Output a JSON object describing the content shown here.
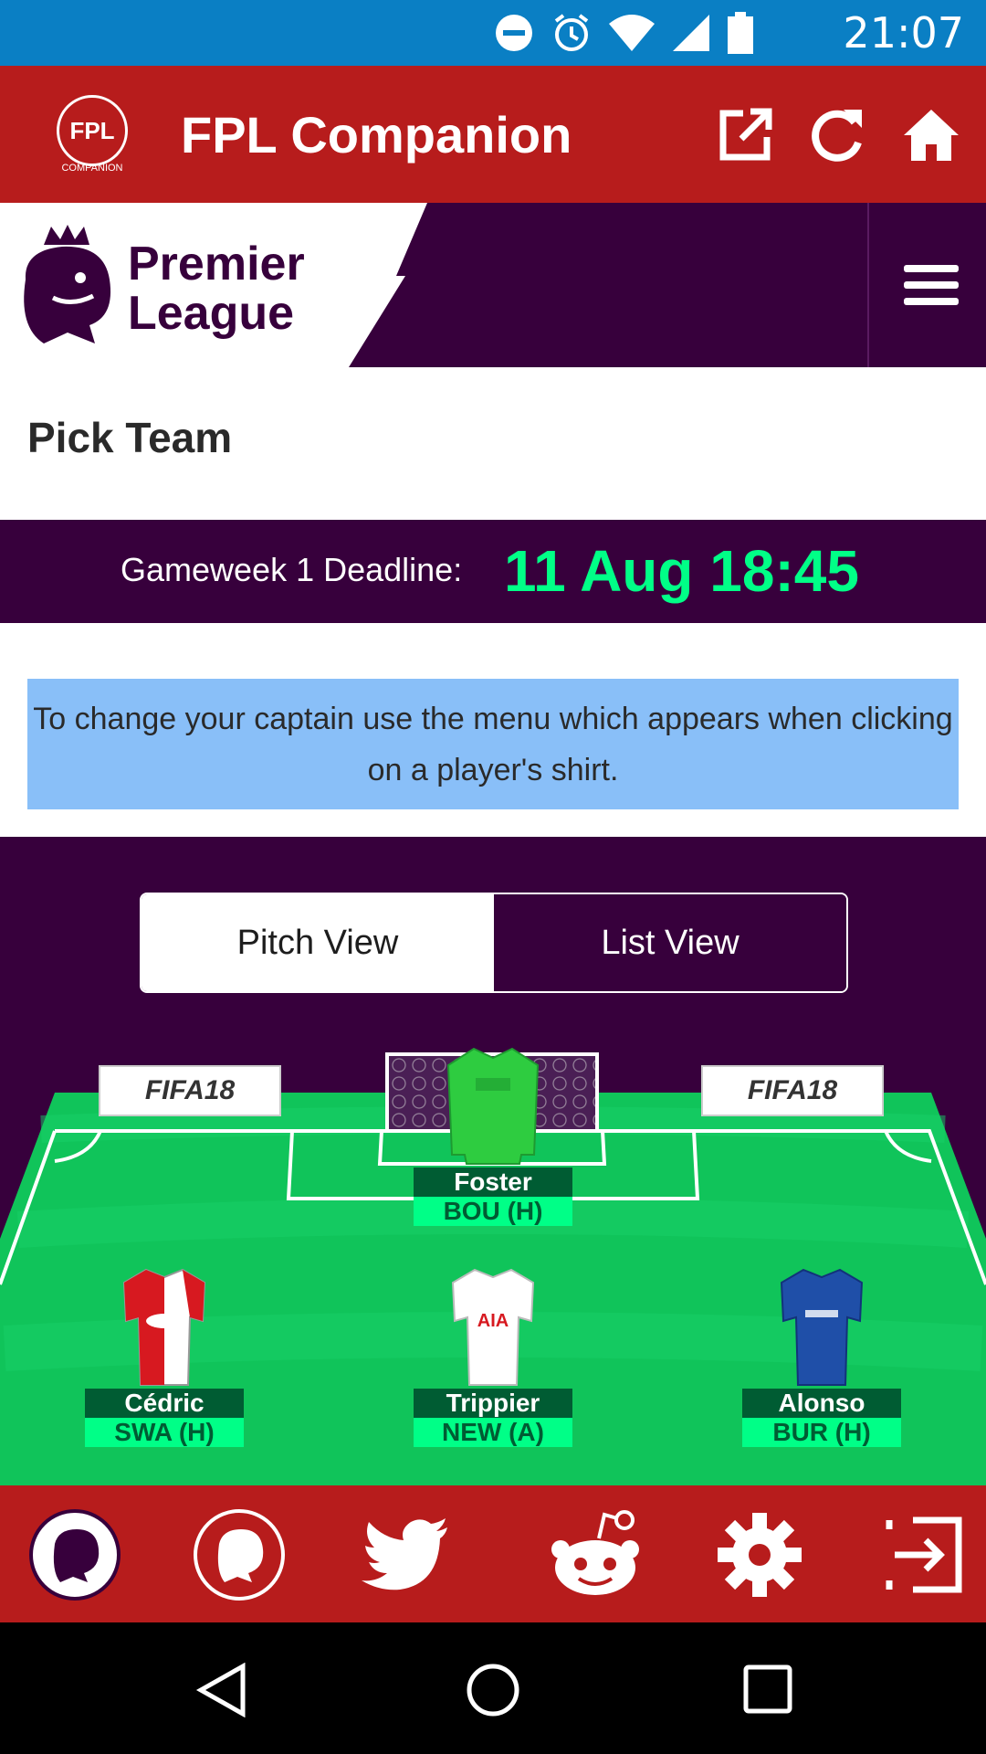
{
  "status_bar": {
    "time": "21:07",
    "icons": [
      "do-not-disturb-icon",
      "alarm-icon",
      "wifi-icon",
      "signal-icon",
      "battery-icon"
    ]
  },
  "app_bar": {
    "logo_text": "FPL",
    "logo_subtext": "COMPANION",
    "title": "FPL Companion",
    "actions": [
      "open-external-icon",
      "refresh-icon",
      "home-icon"
    ]
  },
  "pl_header": {
    "brand_line1": "Premier",
    "brand_line2": "League",
    "menu_icon": "hamburger-menu-icon"
  },
  "page": {
    "title": "Pick Team"
  },
  "deadline": {
    "label": "Gameweek 1 Deadline:",
    "value": "11 Aug 18:45"
  },
  "info": {
    "text": "To change your captain use the menu which appears when clicking on a player's shirt."
  },
  "view_toggle": {
    "options": [
      "Pitch View",
      "List View"
    ],
    "selected": "Pitch View"
  },
  "pitch": {
    "boards": [
      "FIFA18",
      "FIFA18"
    ],
    "players": [
      {
        "name": "Foster",
        "fixture": "BOU (H)",
        "position": "GK",
        "shirt_color": "#2ecc40"
      },
      {
        "name": "Cédric",
        "fixture": "SWA (H)",
        "position": "DEF",
        "shirt_color": "#d71920"
      },
      {
        "name": "Trippier",
        "fixture": "NEW (A)",
        "position": "DEF",
        "shirt_color": "#ffffff"
      },
      {
        "name": "Alonso",
        "fixture": "BUR (H)",
        "position": "DEF",
        "shirt_color": "#1f4fa8"
      }
    ]
  },
  "bottom_nav": {
    "items": [
      "premier-league-icon",
      "premier-league-outline-icon",
      "twitter-icon",
      "reddit-icon",
      "settings-icon",
      "logout-icon"
    ]
  },
  "colors": {
    "red": "#b71c1c",
    "purple": "#37003c",
    "green": "#00ff87",
    "status_blue": "#0a7fc4",
    "info_blue": "#89bff8"
  }
}
